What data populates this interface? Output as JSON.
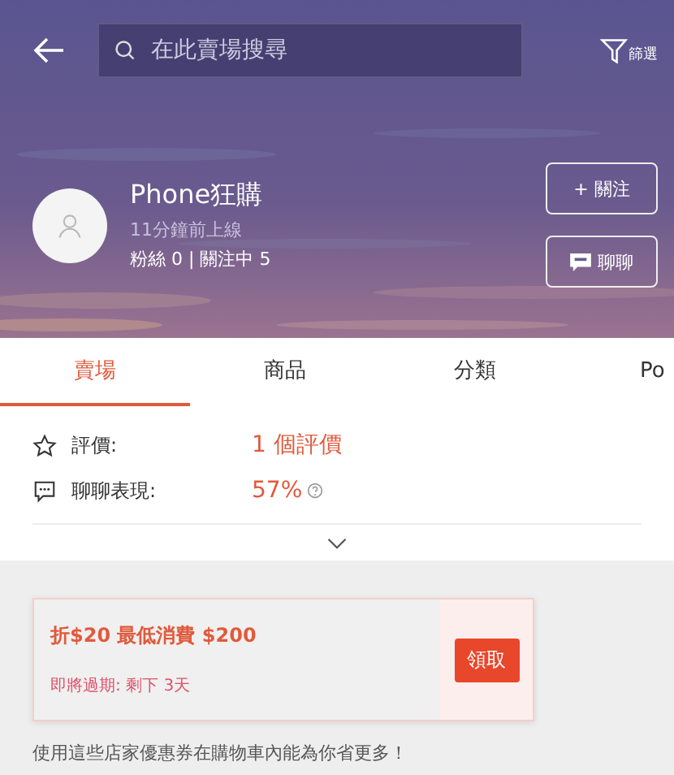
{
  "search": {
    "placeholder": "在此賣場搜尋"
  },
  "filter": {
    "label": "篩選"
  },
  "shop": {
    "name": "Phone狂購",
    "last_online": "11分鐘前上線",
    "stats": "粉絲 0 | 關注中 5"
  },
  "actions": [
    {
      "kind": "follow",
      "label": "+ 關注"
    },
    {
      "kind": "chat",
      "label": "聊聊"
    }
  ],
  "tabs": [
    {
      "label": "賣場",
      "selected": true
    },
    {
      "label": "商品",
      "selected": false
    },
    {
      "label": "分類",
      "selected": false
    },
    {
      "label": "Po",
      "selected": false
    }
  ],
  "info": [
    {
      "kind": "rating",
      "label": "評價:",
      "value": "1 個評價"
    },
    {
      "kind": "chat",
      "label": "聊聊表現:",
      "value": "57%",
      "help": true
    }
  ],
  "coupon": {
    "title": "折$20 最低消費 $200",
    "expiry": "即將過期: 剩下 3天",
    "button": "領取"
  },
  "note": "使用這些店家優惠券在購物車內能為你省更多！"
}
